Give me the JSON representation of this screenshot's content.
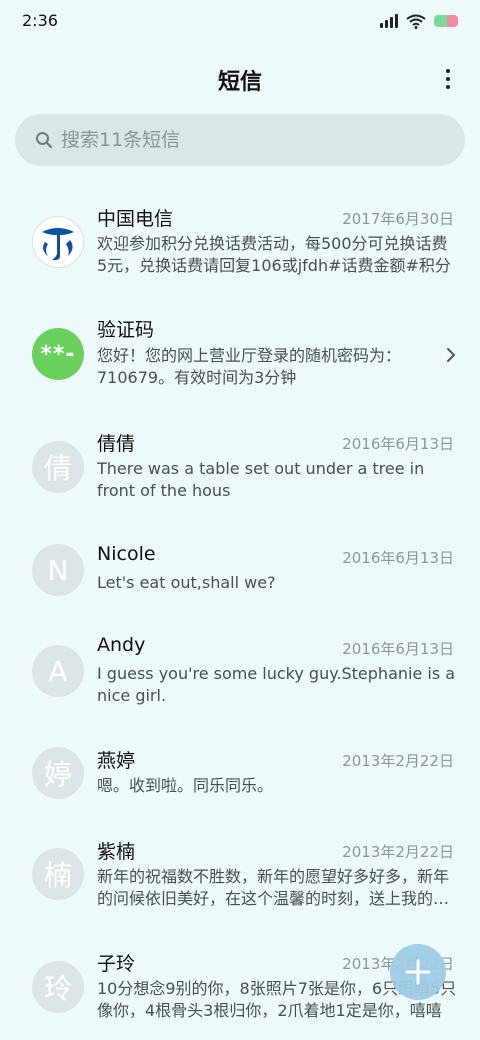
{
  "status": {
    "time": "2:36"
  },
  "header": {
    "title": "短信"
  },
  "search": {
    "placeholder": "搜索11条短信"
  },
  "colors": {
    "background": "#eef9fc",
    "search_bg": "#dbe6e8",
    "fab": "#9fcce5",
    "verify_avatar": "#6ad15c",
    "telecom_blue": "#0b4ea2"
  },
  "conversations": [
    {
      "name": "中国电信",
      "date": "2017年6月30日",
      "preview": "欢迎参加积分兑换话费活动，每500分可兑换话费5元，兑换话费请回复106或jfdh#话费金额#积分",
      "avatar": "china-telecom-logo-icon"
    },
    {
      "name": "验证码",
      "date": "",
      "preview": "您好！您的网上营业厅登录的随机密码为：710679。有效时间为3分钟",
      "avatar_text": "**-"
    },
    {
      "name": "倩倩",
      "date": "2016年6月13日",
      "preview": "There was a table set out under a tree in front of the hous",
      "avatar_text": "倩"
    },
    {
      "name": "Nicole",
      "date": "2016年6月13日",
      "preview": "Let's eat out,shall we?",
      "avatar_text": "N"
    },
    {
      "name": "Andy",
      "date": "2016年6月13日",
      "preview": "I guess you're some lucky guy.Stephanie is a nice girl.",
      "avatar_text": "A"
    },
    {
      "name": "燕婷",
      "date": "2013年2月22日",
      "preview": "嗯。收到啦。同乐同乐。",
      "avatar_text": "婷"
    },
    {
      "name": "紫楠",
      "date": "2013年2月22日",
      "preview": "新年的祝福数不胜数，新年的愿望好多好多，新年的问候依旧美好，在这个温馨的时刻，送上我的祝福",
      "avatar_text": "楠"
    },
    {
      "name": "子玲",
      "date": "2013年2月22日",
      "preview": "10分想念9别的你，8张照片7张是你，6只眼睛5只像你，4根骨头3根归你，2爪着地1定是你，嘻嘻",
      "avatar_text": "玲"
    }
  ]
}
